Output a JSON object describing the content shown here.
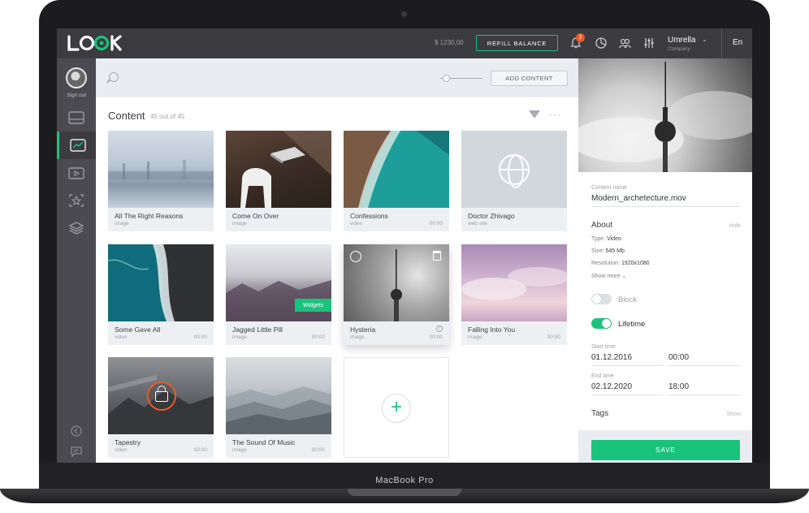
{
  "device": {
    "label": "MacBook Pro"
  },
  "topbar": {
    "balance": "$ 1230,00",
    "refill_label": "REFILL BALANCE",
    "notifications_count": "2",
    "user_name": "Umrella",
    "user_company": "Company",
    "language": "En",
    "icons": [
      "bell-icon",
      "analytics-icon",
      "users-icon",
      "settings-icon"
    ]
  },
  "sidebar": {
    "sign_out": "Sign out",
    "items": [
      "screens",
      "analytics",
      "video",
      "templates",
      "layers"
    ],
    "active": "analytics"
  },
  "toolbar": {
    "add_content_label": "ADD CONTENT"
  },
  "content": {
    "title": "Content",
    "count": "45 out of 45",
    "cards": [
      {
        "title": "All The Right Reasons",
        "type": "image",
        "duration": ""
      },
      {
        "title": "Come On Over",
        "type": "image",
        "duration": ""
      },
      {
        "title": "Confessions",
        "type": "video",
        "duration": "00:00"
      },
      {
        "title": "Doctor Zhivago",
        "type": "web site",
        "duration": ""
      },
      {
        "title": "Some Gave All",
        "type": "video",
        "duration": "00:00"
      },
      {
        "title": "Jagged Little Pill",
        "type": "image",
        "duration": "00:00",
        "badge": "Widgets"
      },
      {
        "title": "Hysteria",
        "type": "image",
        "duration": "00:00"
      },
      {
        "title": "Falling Into You",
        "type": "image",
        "duration": "00:00"
      },
      {
        "title": "Tapestry",
        "type": "video",
        "duration": "00:00"
      },
      {
        "title": "The Sound Of Music",
        "type": "image",
        "duration": "00:00"
      }
    ]
  },
  "details": {
    "content_name_label": "Content name",
    "content_name": "Modern_archetecture.mov",
    "about_label": "About",
    "hide_label": "Hide",
    "type_label": "Type:",
    "type_value": "Video",
    "size_label": "Size:",
    "size_value": "545 Mb",
    "resolution_label": "Resolution:",
    "resolution_value": "1920x1080",
    "show_more": "Show more",
    "block_label": "Block",
    "block_on": false,
    "lifetime_label": "Lifetime",
    "lifetime_on": true,
    "start_time_label": "Start time",
    "start_date": "01.12.2016",
    "start_time": "00:00",
    "end_time_label": "End time",
    "end_date": "02.12.2020",
    "end_time": "18:00",
    "tags_label": "Tags",
    "tags_show": "Show",
    "save_label": "SAVE"
  },
  "colors": {
    "accent": "#19c37d",
    "alert": "#ef5a2a",
    "topbar": "#3b3b40",
    "sidebar": "#4a4a50"
  }
}
